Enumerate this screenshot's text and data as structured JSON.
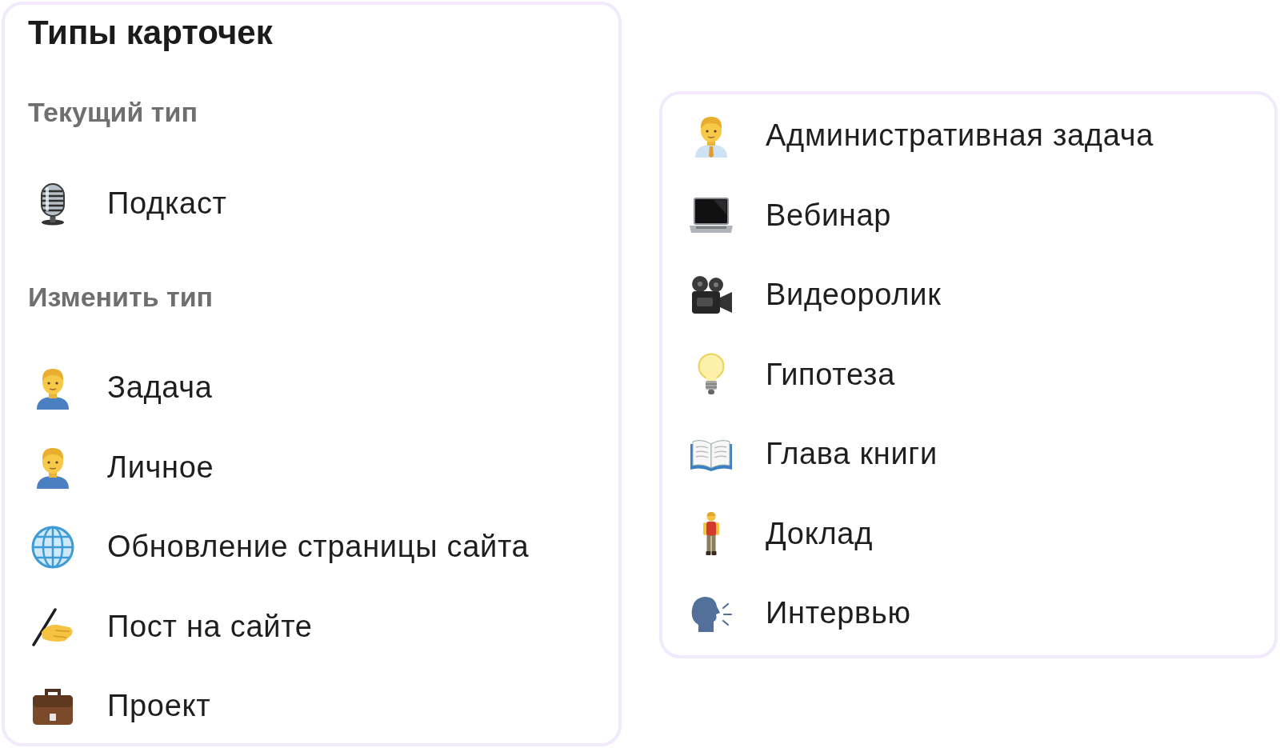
{
  "title": "Типы карточек",
  "current_type": {
    "heading": "Текущий тип",
    "items": [
      "Подкаст"
    ]
  },
  "change_type": {
    "heading": "Изменить тип",
    "items": [
      "Задача",
      "Личное",
      "Обновление страницы сайта",
      "Пост на сайте",
      "Проект"
    ]
  },
  "more_types": {
    "items": [
      "Административная задача",
      "Вебинар",
      "Видеоролик",
      "Гипотеза",
      "Глава книги",
      "Доклад",
      "Интервью"
    ]
  }
}
